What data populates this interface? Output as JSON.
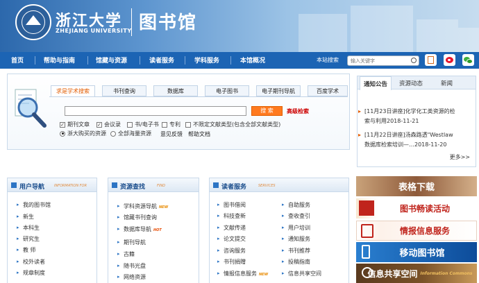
{
  "header": {
    "uni_name": "浙江大学",
    "uni_en": "ZHEJIANG UNIVERSITY",
    "lib_name": "图书馆"
  },
  "nav": {
    "items": [
      "首页",
      "帮助与指南",
      "馆藏与资源",
      "读者服务",
      "学科服务",
      "本馆概况"
    ],
    "site_search_label": "本站搜索",
    "site_search_placeholder": "输入关键字"
  },
  "search": {
    "tabs": [
      "求是学术搜索",
      "书刊查询",
      "数据库",
      "电子图书",
      "电子期刊导航",
      "百度学术"
    ],
    "button": "搜 索",
    "advanced": "高级检索",
    "checkboxes": [
      {
        "label": "期刊文章",
        "checked": true
      },
      {
        "label": "会议录",
        "checked": true
      },
      {
        "label": "书/电子书",
        "checked": false
      },
      {
        "label": "专利",
        "checked": false
      },
      {
        "label": "不限定文献类型(包含全部文献类型)",
        "checked": false
      }
    ],
    "radios": [
      {
        "label": "浙大购买的资源",
        "selected": true
      },
      {
        "label": "全部海量资源",
        "selected": false
      }
    ],
    "links": [
      "意见反馈",
      "帮助文档"
    ]
  },
  "notice": {
    "tabs": [
      "通知公告",
      "资源动态",
      "新闻"
    ],
    "items": [
      {
        "line1": "[11月23日讲座]化学化工类资源的检",
        "line2": "索与利用2018-11-21"
      },
      {
        "line1": "[11月22日讲座]汤森路透\"Westlaw",
        "line2": "数据库检索培训—…2018-11-20"
      }
    ],
    "more": "更多>>"
  },
  "columns": {
    "user_nav": {
      "title": "用户导航",
      "en": "INFORMATION FOR",
      "items": [
        "我的图书馆",
        "新生",
        "本科生",
        "研究生",
        "教  师",
        "校外读者",
        "规章制度"
      ]
    },
    "resources": {
      "title": "资源查找",
      "en": "FIND",
      "items": [
        {
          "label": "学科资源导航",
          "badge": "NEW"
        },
        {
          "label": "馆藏书刊查询",
          "badge": ""
        },
        {
          "label": "数据库导航",
          "badge": "HOT"
        },
        {
          "label": "期刊导航",
          "badge": ""
        },
        {
          "label": "古籍",
          "badge": ""
        },
        {
          "label": "随书光盘",
          "badge": ""
        },
        {
          "label": "网络资源",
          "badge": ""
        }
      ]
    },
    "services": {
      "title": "读者服务",
      "en": "SERVICES",
      "left": [
        {
          "label": "图书借阅",
          "badge": ""
        },
        {
          "label": "科技查新",
          "badge": ""
        },
        {
          "label": "文献传递",
          "badge": ""
        },
        {
          "label": "论文提交",
          "badge": ""
        },
        {
          "label": "咨询服务",
          "badge": ""
        },
        {
          "label": "书刊捐赠",
          "badge": ""
        },
        {
          "label": "情报信息服务",
          "badge": "NEW"
        }
      ],
      "right": [
        "自助服务",
        "查收查引",
        "用户培训",
        "通知服务",
        "书刊推荐",
        "投稿指南",
        "信息共享空间"
      ]
    }
  },
  "banners": {
    "forms": "表格下载",
    "reading": "图书畅读活动",
    "intel": "情报信息服务",
    "mobile": "移动图书馆",
    "commons": "信息共享空间",
    "commons_en": "Information Commons"
  },
  "colors": {
    "nav_blue": "#1c64b4",
    "accent_orange": "#ff7a1f",
    "link_red": "#cc0000"
  }
}
